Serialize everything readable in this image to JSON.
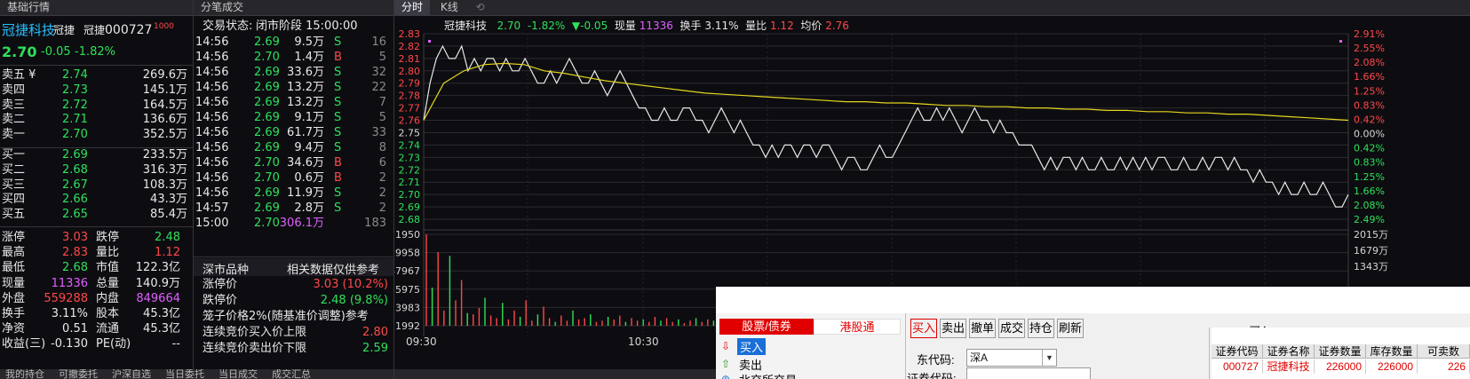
{
  "panels": {
    "basic_quote": "基础行情",
    "tick_trades": "分笔成交",
    "tab_timeshare": "分时",
    "tab_kline": "K线"
  },
  "stock": {
    "name": "冠捷科技",
    "short_name": "冠捷",
    "short_name2": "冠捷",
    "code": "000727",
    "badge": "1000",
    "price": "2.70",
    "change": "-0.05",
    "change_pct": "-1.82%"
  },
  "order_book": {
    "asks": [
      {
        "label": "卖五 ¥",
        "price": "2.74",
        "vol": "269.6万"
      },
      {
        "label": "卖四",
        "price": "2.73",
        "vol": "145.1万"
      },
      {
        "label": "卖三",
        "price": "2.72",
        "vol": "164.5万"
      },
      {
        "label": "卖二",
        "price": "2.71",
        "vol": "136.6万"
      },
      {
        "label": "卖一",
        "price": "2.70",
        "vol": "352.5万"
      }
    ],
    "bids": [
      {
        "label": "买一",
        "price": "2.69",
        "vol": "233.5万"
      },
      {
        "label": "买二",
        "price": "2.68",
        "vol": "316.3万"
      },
      {
        "label": "买三",
        "price": "2.67",
        "vol": "108.3万"
      },
      {
        "label": "买四",
        "price": "2.66",
        "vol": "43.3万"
      },
      {
        "label": "买五",
        "price": "2.65",
        "vol": "85.4万"
      }
    ]
  },
  "stats": [
    {
      "l1": "涨停",
      "v1": "3.03",
      "l2": "跌停",
      "v2": "2.48"
    },
    {
      "l1": "最高",
      "v1": "2.83",
      "l2": "量比",
      "v2": "1.12"
    },
    {
      "l1": "最低",
      "v1": "2.68",
      "l2": "市值",
      "v2": "122.3亿"
    },
    {
      "l1": "现量",
      "v1": "11336",
      "l2": "总量",
      "v2": "140.9万"
    },
    {
      "l1": "外盘",
      "v1": "559288",
      "l2": "内盘",
      "v2": "849664"
    },
    {
      "l1": "换手",
      "v1": "3.11%",
      "l2": "股本",
      "v2": "45.3亿"
    },
    {
      "l1": "净资",
      "v1": "0.51",
      "l2": "流通",
      "v2": "45.3亿"
    },
    {
      "l1": "收益(三)",
      "v1": "-0.130",
      "l2": "PE(动)",
      "v2": "--"
    }
  ],
  "bottom_tabs": [
    "我的持仓",
    "可撤委托",
    "沪深自选",
    "当日委托",
    "当日成交",
    "成交汇总"
  ],
  "trade_status": {
    "label": "交易状态:",
    "value": "闭市阶段 15:00:00"
  },
  "ticks": [
    {
      "t": "14:56",
      "p": "2.69",
      "v": "9.5万",
      "d": "S",
      "n": "16"
    },
    {
      "t": "14:56",
      "p": "2.70",
      "v": "1.4万",
      "d": "B",
      "n": "5"
    },
    {
      "t": "14:56",
      "p": "2.69",
      "v": "33.6万",
      "d": "S",
      "n": "32"
    },
    {
      "t": "14:56",
      "p": "2.69",
      "v": "13.2万",
      "d": "S",
      "n": "22"
    },
    {
      "t": "14:56",
      "p": "2.69",
      "v": "13.2万",
      "d": "S",
      "n": "7"
    },
    {
      "t": "14:56",
      "p": "2.69",
      "v": "9.1万",
      "d": "S",
      "n": "5"
    },
    {
      "t": "14:56",
      "p": "2.69",
      "v": "61.7万",
      "d": "S",
      "n": "33"
    },
    {
      "t": "14:56",
      "p": "2.69",
      "v": "9.4万",
      "d": "S",
      "n": "8"
    },
    {
      "t": "14:56",
      "p": "2.70",
      "v": "34.6万",
      "d": "B",
      "n": "6"
    },
    {
      "t": "14:56",
      "p": "2.70",
      "v": "0.6万",
      "d": "B",
      "n": "2"
    },
    {
      "t": "14:56",
      "p": "2.69",
      "v": "11.9万",
      "d": "S",
      "n": "2"
    },
    {
      "t": "14:57",
      "p": "2.69",
      "v": "2.8万",
      "d": "S",
      "n": "2"
    },
    {
      "t": "15:00",
      "p": "2.70",
      "v": "306.1万",
      "d": "",
      "n": "183"
    }
  ],
  "market_info": {
    "title": "深市品种",
    "note": "相关数据仅供参考",
    "limit_up_label": "涨停价",
    "limit_up_value": "3.03 (10.2%)",
    "limit_down_label": "跌停价",
    "limit_down_value": "2.48 (9.8%)",
    "cage_rule": "笼子价格2%(随基准价调整)参考",
    "upper_label": "连续竞价买入价上限",
    "upper_value": "2.80",
    "lower_label": "连续竞价卖出价下限",
    "lower_value": "2.59"
  },
  "chart_header": {
    "name": "冠捷科技",
    "price": "2.70",
    "pct": "-1.82%",
    "arrow": "▼",
    "chg": "-0.05",
    "vol_label": "现量",
    "vol": "11336",
    "turnover_label": "换手",
    "turnover": "3.11%",
    "ratio_label": "量比",
    "ratio": "1.12",
    "avg_label": "均价",
    "avg": "2.76"
  },
  "chart_data": {
    "type": "line",
    "y_labels": [
      "2.83",
      "2.82",
      "2.81",
      "2.80",
      "2.79",
      "2.78",
      "2.77",
      "2.76",
      "2.75",
      "2.74",
      "2.73",
      "2.72",
      "2.71",
      "2.70",
      "2.69",
      "2.68"
    ],
    "pct_labels": [
      "2.91%",
      "2.55%",
      "2.08%",
      "1.66%",
      "1.25%",
      "0.83%",
      "0.42%",
      "0.00%",
      "0.42%",
      "0.83%",
      "1.25%",
      "1.66%",
      "2.08%",
      "2.49%"
    ],
    "ylim": [
      2.68,
      2.83
    ],
    "vol_labels": [
      "71950",
      "59958",
      "47967",
      "35975",
      "23983",
      "11992"
    ],
    "vol_right_labels": [
      "2015万",
      "1679万",
      "1343万"
    ],
    "x_labels": [
      "09:30",
      "10:30"
    ],
    "series": [
      {
        "values": [
          2.76,
          2.79,
          2.81,
          2.82,
          2.81,
          2.81,
          2.82,
          2.8,
          2.81,
          2.8,
          2.81,
          2.81,
          2.8,
          2.81,
          2.8,
          2.8,
          2.81,
          2.8,
          2.79,
          2.79,
          2.8,
          2.79,
          2.8,
          2.81,
          2.8,
          2.79,
          2.79,
          2.8,
          2.79,
          2.78,
          2.79,
          2.8,
          2.79,
          2.78,
          2.77,
          2.77,
          2.76,
          2.76,
          2.77,
          2.76,
          2.76,
          2.77,
          2.77,
          2.76,
          2.76,
          2.75,
          2.76,
          2.77,
          2.76,
          2.75,
          2.76,
          2.75,
          2.74,
          2.74,
          2.73,
          2.74,
          2.73,
          2.74,
          2.74,
          2.73,
          2.74,
          2.74,
          2.73,
          2.74,
          2.74,
          2.73,
          2.72,
          2.73,
          2.73,
          2.72,
          2.72,
          2.73,
          2.74,
          2.73,
          2.73,
          2.74,
          2.75,
          2.76,
          2.77,
          2.76,
          2.76,
          2.77,
          2.76,
          2.77,
          2.76,
          2.75,
          2.76,
          2.77,
          2.76,
          2.76,
          2.75,
          2.76,
          2.75,
          2.75,
          2.74,
          2.74,
          2.74,
          2.73,
          2.72,
          2.73,
          2.72,
          2.73,
          2.73,
          2.72,
          2.73,
          2.72,
          2.72,
          2.73,
          2.72,
          2.72,
          2.73,
          2.72,
          2.73,
          2.72,
          2.73,
          2.72,
          2.73,
          2.73,
          2.72,
          2.72,
          2.73,
          2.72,
          2.72,
          2.73,
          2.72,
          2.73,
          2.73,
          2.72,
          2.73,
          2.72,
          2.72,
          2.71,
          2.72,
          2.71,
          2.71,
          2.7,
          2.71,
          2.7,
          2.7,
          2.71,
          2.7,
          2.7,
          2.71,
          2.7,
          2.69,
          2.69,
          2.7
        ]
      },
      {
        "values": [
          2.76,
          2.79,
          2.8,
          2.805,
          2.806,
          2.805,
          2.8,
          2.798,
          2.795,
          2.792,
          2.79,
          2.788,
          2.786,
          2.784,
          2.782,
          2.781,
          2.78,
          2.779,
          2.778,
          2.777,
          2.776,
          2.775,
          2.775,
          2.774,
          2.774,
          2.773,
          2.772,
          2.772,
          2.771,
          2.771,
          2.77,
          2.77,
          2.769,
          2.769,
          2.768,
          2.768,
          2.767,
          2.767,
          2.766,
          2.766,
          2.765,
          2.765,
          2.764,
          2.763,
          2.762,
          2.761,
          2.76
        ]
      }
    ],
    "volume_values": [
      72,
      30,
      58,
      12,
      55,
      20,
      36,
      10,
      9,
      14,
      22,
      8,
      6,
      18,
      5,
      12,
      7,
      20,
      4,
      9,
      15,
      6,
      3,
      8,
      4,
      12,
      5,
      6,
      9,
      3,
      4,
      7,
      5,
      8,
      3,
      6,
      4,
      5,
      3,
      7,
      4,
      6,
      3,
      5,
      2,
      4,
      6,
      3,
      5,
      4
    ]
  },
  "dialog": {
    "tab1": "股票/债券",
    "tab2": "港股通",
    "item_buy": "买入",
    "item_sell": "卖出",
    "item_bj": "北交所交易",
    "toolbar": [
      "买入",
      "卖出",
      "撤单",
      "成交",
      "持仓",
      "刷新"
    ],
    "title": "买入",
    "account_label": "东代码:",
    "account_value": "深A",
    "code_label": "证券代码:",
    "table_headers": [
      "证券代码",
      "证券名称",
      "证券数量",
      "库存数量",
      "可卖数"
    ],
    "table_row": [
      "000727",
      "冠捷科技",
      "226000",
      "226000",
      "226"
    ]
  }
}
